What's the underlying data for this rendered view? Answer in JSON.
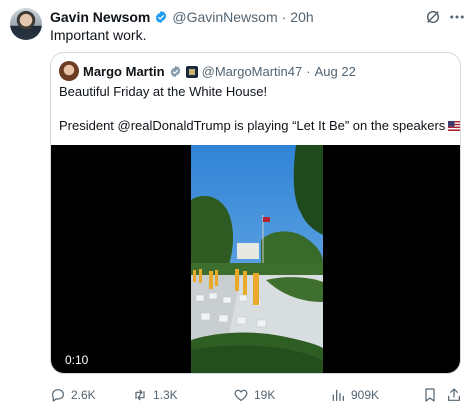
{
  "tweet": {
    "author_name": "Gavin Newsom",
    "handle": "@GavinNewsom",
    "separator": "·",
    "time": "20h",
    "text": "Important work."
  },
  "quoted": {
    "author_name": "Margo Martin",
    "handle": "@MargoMartin47",
    "separator": "·",
    "date": "Aug 22",
    "line1": "Beautiful Friday at the White House!",
    "line2": "President @realDonaldTrump is playing “Let It Be” on the speakers",
    "video_timestamp": "0:10"
  },
  "actions": {
    "replies": "2.6K",
    "reposts": "1.3K",
    "likes": "19K",
    "views": "909K"
  },
  "colors": {
    "verified_blue": "#1d9bf0",
    "muted_text": "#536471",
    "border": "#cfd9de"
  },
  "icons": [
    "verified-badge-icon",
    "grok-icon",
    "more-icon",
    "reply-icon",
    "repost-icon",
    "like-icon",
    "views-icon",
    "bookmark-icon",
    "share-icon",
    "flag-icon"
  ]
}
